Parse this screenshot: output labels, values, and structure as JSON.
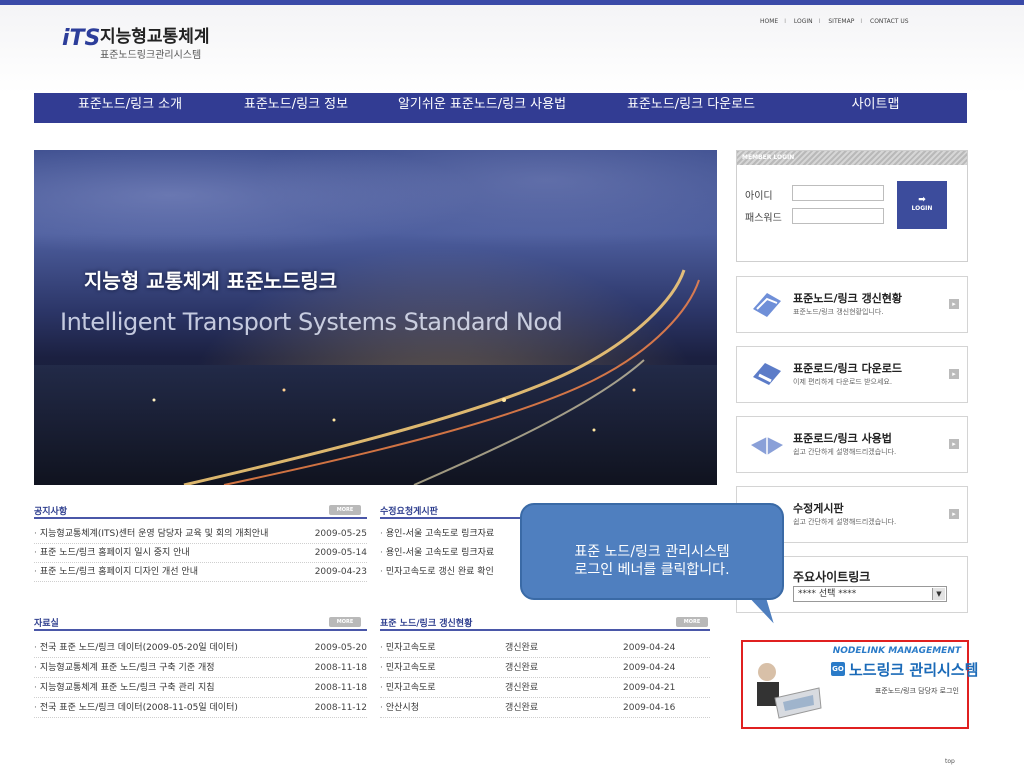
{
  "brand": {
    "logo_mark": "iTS",
    "title": "지능형교통체계",
    "subtitle": "표준노드링크관리시스템"
  },
  "util_links": [
    "HOME",
    "LOGIN",
    "SITEMAP",
    "CONTACT US"
  ],
  "nav": [
    "표준노드/링크 소개",
    "표준노드/링크 정보",
    "알기쉬운 표준노드/링크 사용법",
    "표준노드/링크 다운로드",
    "사이트맵"
  ],
  "hero": {
    "title": "지능형 교통체계 표준노드링크",
    "subtitle": "Intelligent Transport Systems Standard Nod"
  },
  "login": {
    "header": "MEMBER LOGIN",
    "id_label": "아이디",
    "pw_label": "패스워드",
    "button": "LOGIN"
  },
  "quick": [
    {
      "title": "표준노드/링크 갱신현황",
      "sub": "표준노드/링크 갱신현황입니다.",
      "icon": "update-icon"
    },
    {
      "title": "표준로드/링크 다운로드",
      "sub": "이제 편리하게 다운로드 받으세요.",
      "icon": "download-icon"
    },
    {
      "title": "표준로드/링크 사용법",
      "sub": "쉽고 간단하게 설명해드리겠습니다.",
      "icon": "book-icon"
    },
    {
      "title": "수정게시판",
      "sub": "쉽고 간단하게 설명해드리겠습니다.",
      "icon": "edit-icon"
    }
  ],
  "sites": {
    "title": "주요사이트링크",
    "selected": "**** 선택 ****"
  },
  "banner": {
    "eng": "NODELINK MANAGEMENT",
    "go": "GO",
    "title": "노드링크 관리시스템",
    "sub": "표준노드/링크 담당자 로그인"
  },
  "more_label": "MORE",
  "notice": {
    "title": "공지사항",
    "rows": [
      {
        "text": "지능형교통체계(ITS)센터 운영 담당자 교육 및 회의 개최안내",
        "date": "2009-05-25"
      },
      {
        "text": "표준 노드/링크 홈페이지 일시 중지 안내",
        "date": "2009-05-14"
      },
      {
        "text": "표준 노드/링크 홈페이지 디자인 개선 안내",
        "date": "2009-04-23"
      }
    ]
  },
  "request": {
    "title": "수정요청게시판",
    "rows": [
      {
        "text": "용인-서울 고속도로 링크자료"
      },
      {
        "text": "용인-서울 고속도로 링크자료"
      },
      {
        "text": "민자고속도로 갱신 완료 확인"
      }
    ]
  },
  "library": {
    "title": "자료실",
    "rows": [
      {
        "text": "전국 표준 노드/링크 데이터(2009-05-20일 데이터)",
        "date": "2009-05-20"
      },
      {
        "text": "지능형교통체계 표준 노드/링크 구축 기준 개정",
        "date": "2008-11-18"
      },
      {
        "text": "지능형교통체계 표준 노드/링크 구축 관리 지침",
        "date": "2008-11-18"
      },
      {
        "text": "전국 표준 노드/링크 데이터(2008-11-05일 데이터)",
        "date": "2008-11-12"
      }
    ]
  },
  "status": {
    "title": "표준 노드/링크 갱신현황",
    "rows": [
      {
        "text": "민자고속도로",
        "state": "갱신완료",
        "date": "2009-04-24"
      },
      {
        "text": "민자고속도로",
        "state": "갱신완료",
        "date": "2009-04-24"
      },
      {
        "text": "민자고속도로",
        "state": "갱신완료",
        "date": "2009-04-21"
      },
      {
        "text": "안산시청",
        "state": "갱신완료",
        "date": "2009-04-16"
      }
    ]
  },
  "callout": {
    "line1": "표준 노드/링크 관리시스템",
    "line2": "로그인 베너를 클릭합니다."
  },
  "footer_top": "top"
}
